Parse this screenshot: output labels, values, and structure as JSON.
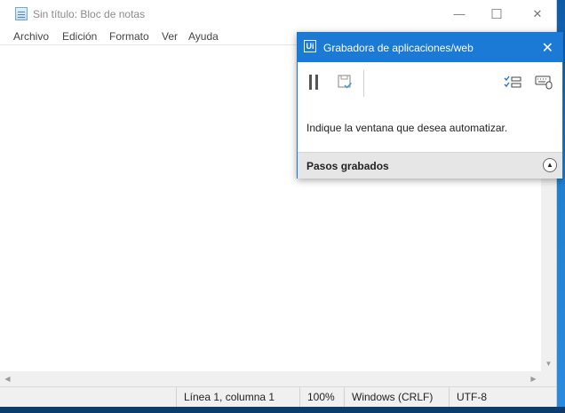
{
  "notepad": {
    "title": "Sin título: Bloc de notas",
    "window_controls": {
      "minimize": "—",
      "maximize": "☐",
      "close": "✕"
    },
    "menu": [
      "Archivo",
      "Edición",
      "Formato",
      "Ver",
      "Ayuda"
    ],
    "status": {
      "position": "Línea 1, columna 1",
      "zoom": "100%",
      "line_ending": "Windows (CRLF)",
      "encoding": "UTF-8"
    }
  },
  "recorder": {
    "title": "Grabadora de aplicaciones/web",
    "logo_text": "Ui",
    "close": "✕",
    "message": "Indique la ventana que desea automatizar.",
    "steps_label": "Pasos grabados",
    "colors": {
      "titlebar": "#1a7ad6"
    },
    "toolbar_icons": [
      "pause-icon",
      "save-icon",
      "steps-list-icon",
      "keyboard-mouse-icon"
    ]
  }
}
